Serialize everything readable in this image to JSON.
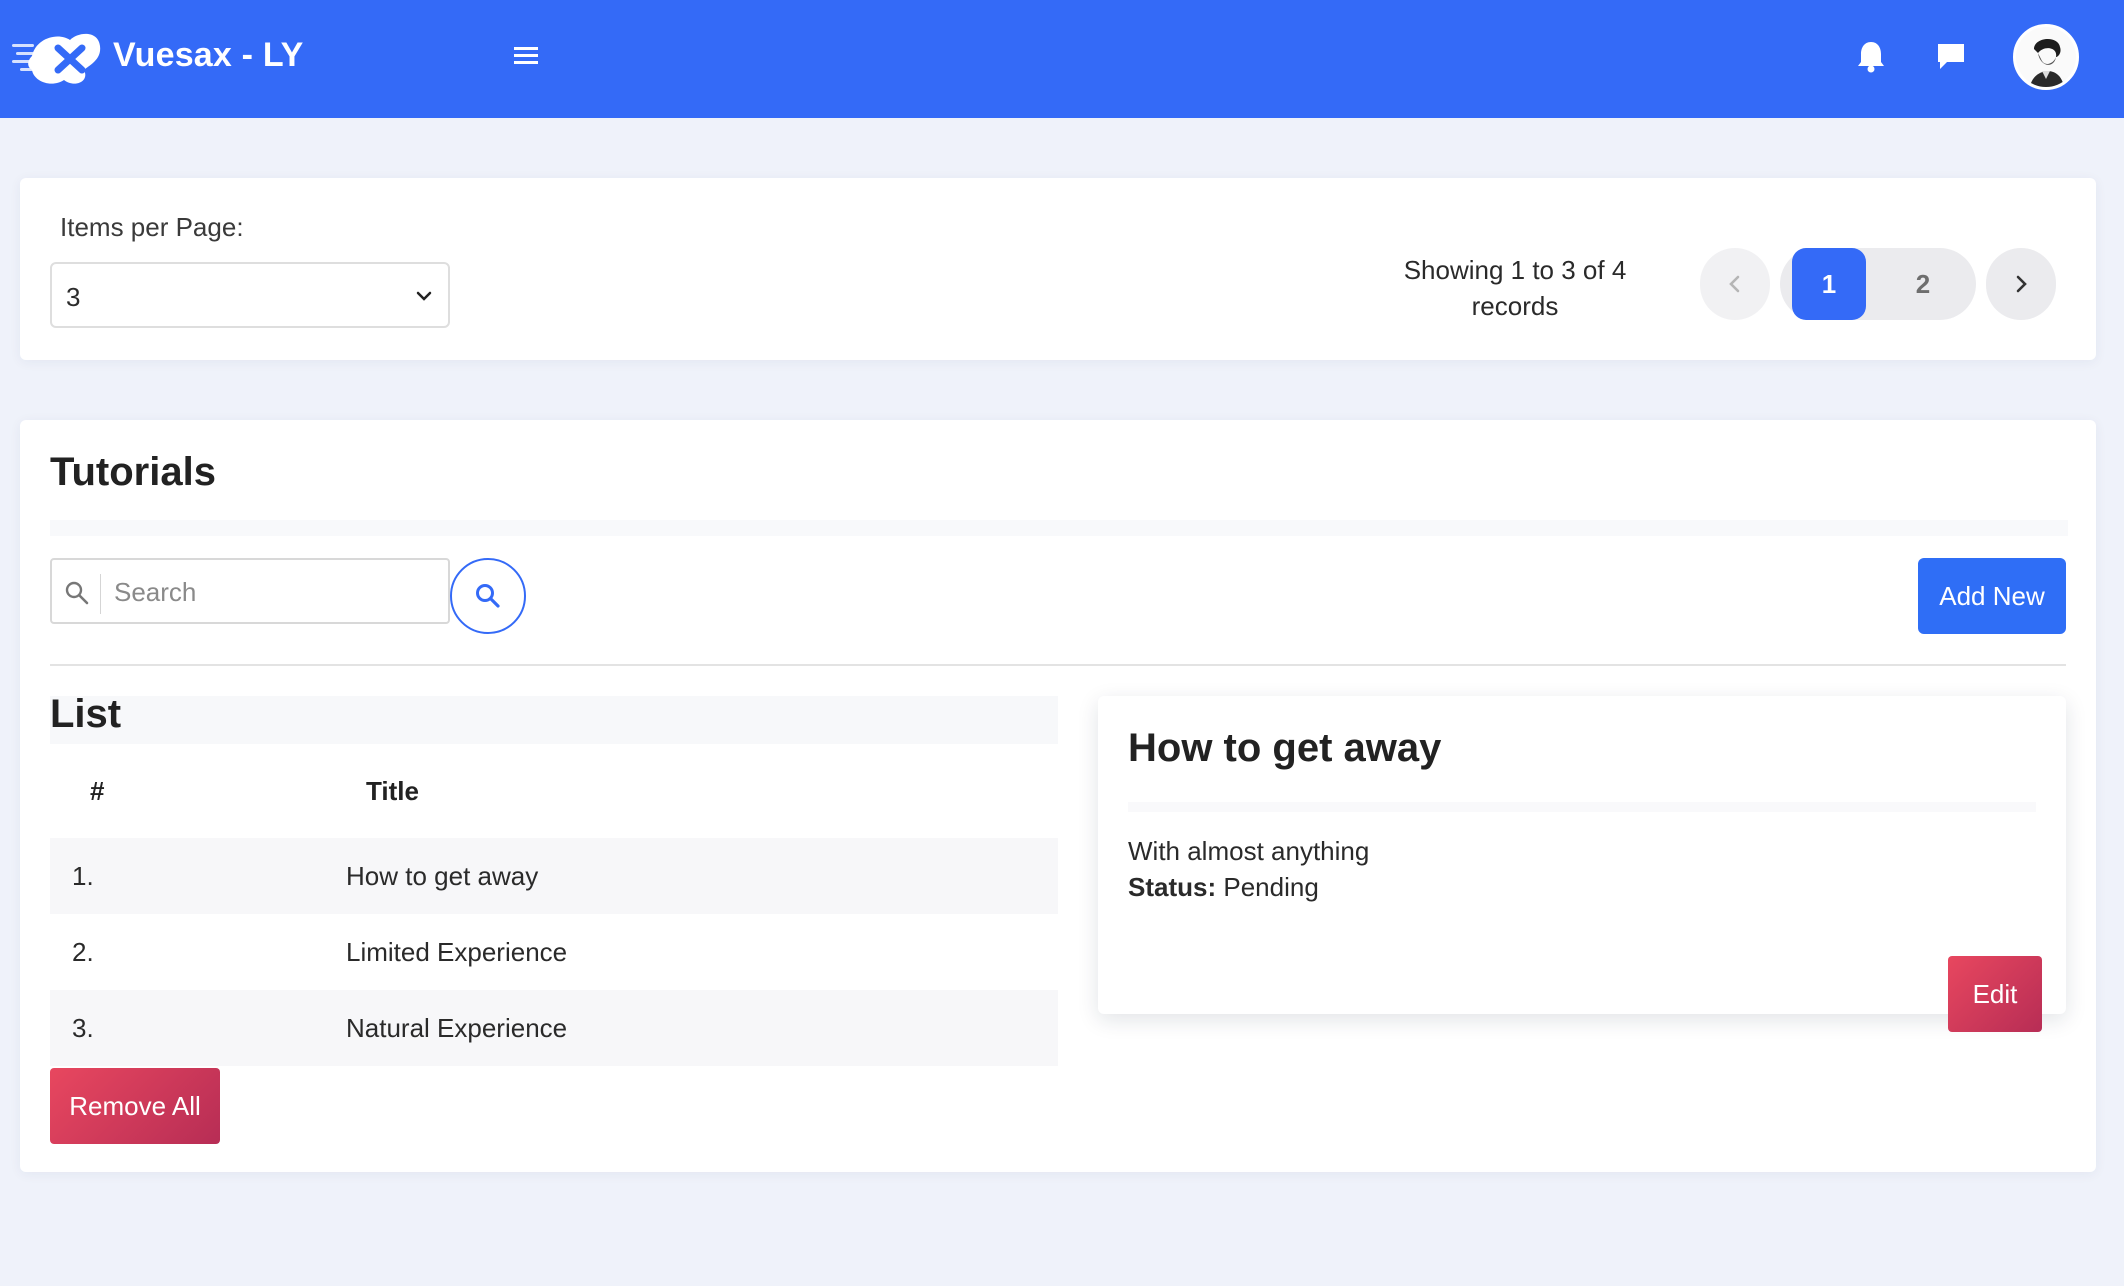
{
  "colors": {
    "navbar": "#346af7",
    "primary": "#2f6ef6",
    "danger": "#d63c5b",
    "page_bg": "#eff2fa"
  },
  "navbar": {
    "brand": "Vuesax - LY",
    "logo_icon": "vuesax-logo",
    "menu_icon": "hamburger-menu",
    "notification_icon": "bell",
    "messages_icon": "chat-bubble",
    "avatar_icon": "user-avatar"
  },
  "pager": {
    "items_label": "Items per Page:",
    "items_value": "3",
    "showing": "Showing 1 to 3 of 4",
    "showing_line2": "records",
    "pages": [
      "1",
      "2"
    ],
    "current_page": "1",
    "prev_icon": "chevron-left",
    "next_icon": "chevron-right"
  },
  "tutorials": {
    "title": "Tutorials",
    "search_placeholder": "Search",
    "search_value": "",
    "add_new": "Add New",
    "list_title": "List",
    "columns": [
      "#",
      "Title"
    ],
    "rows": [
      {
        "num": "1.",
        "title": "How to get away"
      },
      {
        "num": "2.",
        "title": "Limited Experience"
      },
      {
        "num": "3.",
        "title": "Natural Experience"
      }
    ],
    "remove_all": "Remove All"
  },
  "detail": {
    "title": "How to get away",
    "description": "With almost anything",
    "status_label": "Status:",
    "status_value": "Pending",
    "edit": "Edit"
  }
}
